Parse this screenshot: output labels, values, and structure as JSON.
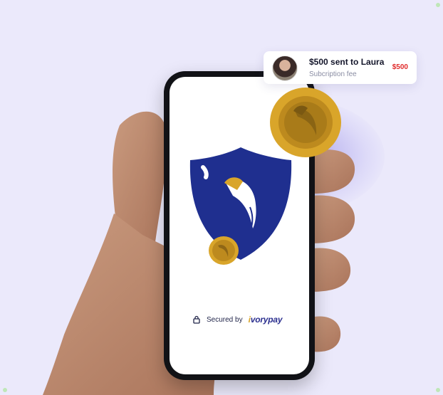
{
  "notification": {
    "title": "$500 sent to Laura",
    "subtitle": "Subcription fee",
    "amount": "$500",
    "amount_color": "#e02a2a"
  },
  "screen": {
    "secured_label": "Secured by",
    "brand_prefix": "i",
    "brand_rest": "vorypay"
  },
  "colors": {
    "background": "#ebe9fb",
    "shield": "#1f2f8f",
    "coin_gold": "#d9a52a",
    "phone_body": "#111216"
  },
  "icons": [
    "lock-icon",
    "shield-icon",
    "coin-icon",
    "ivorypay-logo"
  ]
}
